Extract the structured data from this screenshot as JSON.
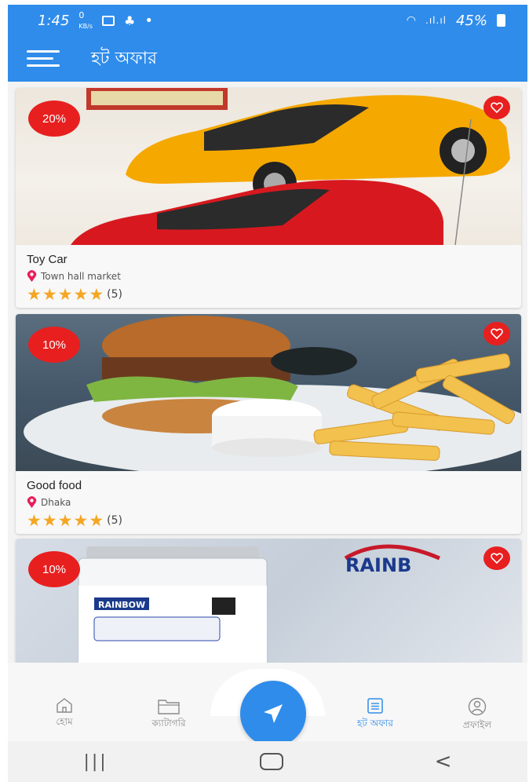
{
  "status_bar": {
    "time": "1:45",
    "net_speed": "0 KB/s",
    "battery": "45%"
  },
  "header": {
    "title": "হট অফার",
    "menu_icon": "hamburger-icon"
  },
  "offers": [
    {
      "discount": "20%",
      "title": "Toy Car",
      "location": "Town hall market",
      "stars": 5,
      "rating_count": "(5)",
      "image": "toy-cars"
    },
    {
      "discount": "10%",
      "title": "Good food",
      "location": "Dhaka",
      "stars": 5,
      "rating_count": "(5)",
      "image": "burger-fries"
    },
    {
      "discount": "10%",
      "title": "",
      "location": "",
      "stars": 0,
      "rating_count": "",
      "image": "rainbow-paint-bucket",
      "brand_text": "RAINBOW",
      "logo_text": "RAINB"
    }
  ],
  "bottom_nav": {
    "items": [
      {
        "label": "হোম",
        "icon": "home-icon"
      },
      {
        "label": "ক্যাটাগরি",
        "icon": "folder-icon"
      },
      {
        "label": "হট অফার",
        "icon": "list-icon",
        "active": true
      },
      {
        "label": "প্রফাইল",
        "icon": "profile-icon"
      }
    ],
    "fab_icon": "navigation-arrow-icon"
  },
  "colors": {
    "primary": "#2f8ceb",
    "badge": "#e81f1f",
    "star": "#f5a623"
  }
}
